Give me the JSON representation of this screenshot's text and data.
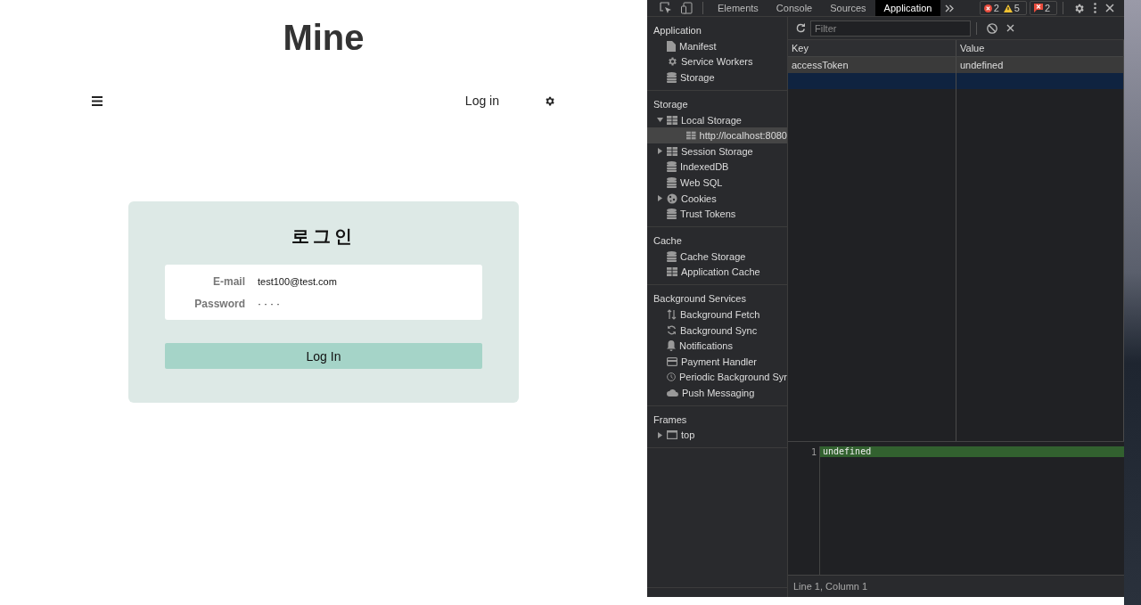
{
  "page": {
    "title": "Mine",
    "nav": {
      "login_link": "Log in"
    },
    "login_card": {
      "heading": "로그인",
      "fields": [
        {
          "label": "E-mail",
          "value": "test100@test.com",
          "kind": "text"
        },
        {
          "label": "Password",
          "value": "····",
          "kind": "password"
        }
      ],
      "button": "Log In"
    }
  },
  "devtools": {
    "tabs": [
      {
        "label": "Elements",
        "selected": false
      },
      {
        "label": "Console",
        "selected": false
      },
      {
        "label": "Sources",
        "selected": false
      },
      {
        "label": "Application",
        "selected": true
      }
    ],
    "counters": [
      {
        "kind": "error",
        "count": "2"
      },
      {
        "kind": "warning",
        "count": "5"
      },
      {
        "kind": "issue",
        "count": "2"
      }
    ],
    "sidebar": [
      {
        "title": "Application",
        "items": [
          {
            "label": "Manifest",
            "kind": "file",
            "selected": false
          },
          {
            "label": "Service Workers",
            "kind": "gear",
            "selected": false
          },
          {
            "label": "Storage",
            "kind": "database",
            "selected": false
          }
        ]
      },
      {
        "title": "Storage",
        "items": [
          {
            "label": "Local Storage",
            "kind": "grid",
            "selected": false,
            "expanded": true,
            "children": [
              {
                "label": "http://localhost:8080",
                "kind": "grid",
                "selected": true
              }
            ]
          },
          {
            "label": "Session Storage",
            "kind": "grid",
            "selected": false,
            "expanded": false
          },
          {
            "label": "IndexedDB",
            "kind": "database",
            "selected": false
          },
          {
            "label": "Web SQL",
            "kind": "database",
            "selected": false
          },
          {
            "label": "Cookies",
            "kind": "cookie",
            "selected": false,
            "expanded": false
          },
          {
            "label": "Trust Tokens",
            "kind": "database",
            "selected": false
          }
        ]
      },
      {
        "title": "Cache",
        "items": [
          {
            "label": "Cache Storage",
            "kind": "database",
            "selected": false
          },
          {
            "label": "Application Cache",
            "kind": "grid",
            "selected": false
          }
        ]
      },
      {
        "title": "Background Services",
        "items": [
          {
            "label": "Background Fetch",
            "kind": "updown",
            "selected": false
          },
          {
            "label": "Background Sync",
            "kind": "sync",
            "selected": false
          },
          {
            "label": "Notifications",
            "kind": "bell",
            "selected": false
          },
          {
            "label": "Payment Handler",
            "kind": "card",
            "selected": false
          },
          {
            "label": "Periodic Background Syr",
            "kind": "clock",
            "selected": false
          },
          {
            "label": "Push Messaging",
            "kind": "cloud",
            "selected": false
          }
        ]
      },
      {
        "title": "Frames",
        "items": [
          {
            "label": "top",
            "kind": "frame",
            "selected": false,
            "expanded": false
          }
        ]
      }
    ],
    "filter": {
      "placeholder": "Filter"
    },
    "table": {
      "columns": [
        "Key",
        "Value"
      ],
      "rows": [
        {
          "key": "accessToken",
          "value": "undefined",
          "selected": false
        },
        {
          "selected": true
        }
      ]
    },
    "preview": {
      "line_number": "1",
      "line": "undefined"
    },
    "status_bar": "Line 1, Column 1"
  }
}
